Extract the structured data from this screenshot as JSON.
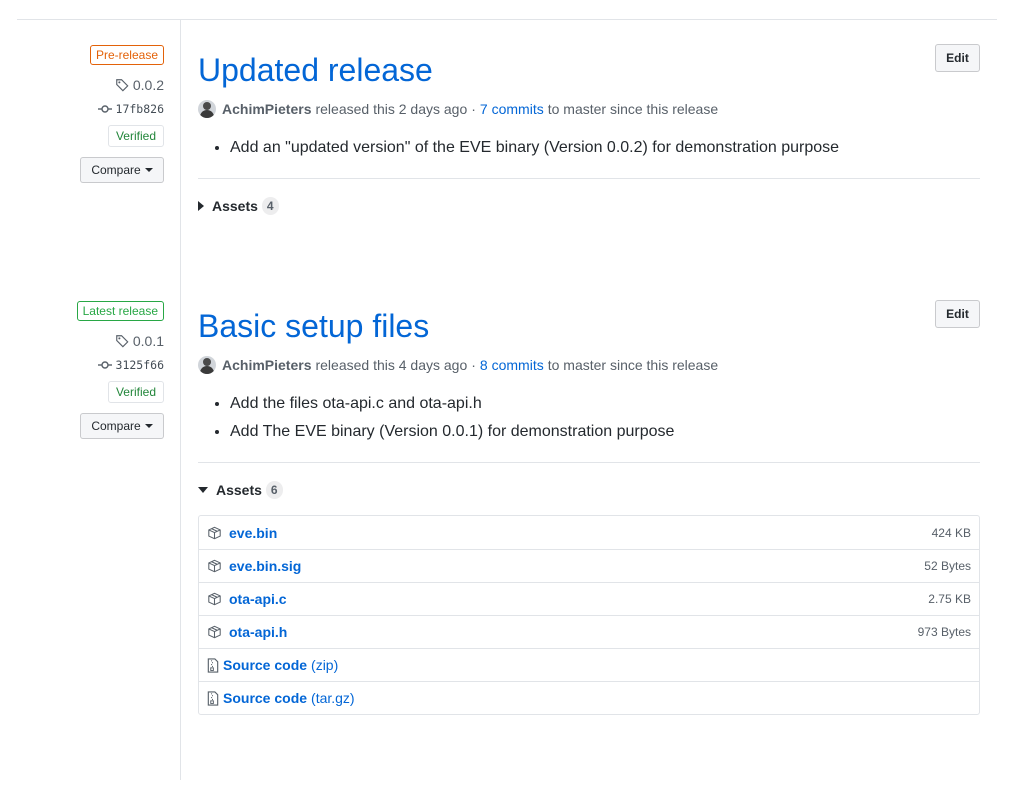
{
  "releases": [
    {
      "label": "Pre-release",
      "tag": "0.0.2",
      "commit": "17fb826",
      "verified": "Verified",
      "compare": "Compare",
      "edit": "Edit",
      "title": "Updated release",
      "author": "AchimPieters",
      "released_text": "released this 2 days ago",
      "sep": "·",
      "commits_link": "7 commits",
      "commits_suffix": "to master since this release",
      "notes": [
        "Add an \"updated version\" of the EVE binary (Version 0.0.2) for demonstration purpose"
      ],
      "assets_label": "Assets",
      "assets_count": "4",
      "assets_expanded": false
    },
    {
      "label": "Latest release",
      "tag": "0.0.1",
      "commit": "3125f66",
      "verified": "Verified",
      "compare": "Compare",
      "edit": "Edit",
      "title": "Basic setup files",
      "author": "AchimPieters",
      "released_text": "released this 4 days ago",
      "sep": "·",
      "commits_link": "8 commits",
      "commits_suffix": "to master since this release",
      "notes": [
        "Add the files ota-api.c and ota-api.h",
        "Add The EVE binary (Version 0.0.1) for demonstration purpose"
      ],
      "assets_label": "Assets",
      "assets_count": "6",
      "assets_expanded": true,
      "assets": [
        {
          "name": "eve.bin",
          "size": "424 KB",
          "icon": "package-icon"
        },
        {
          "name": "eve.bin.sig",
          "size": "52 Bytes",
          "icon": "package-icon"
        },
        {
          "name": "ota-api.c",
          "size": "2.75 KB",
          "icon": "package-icon"
        },
        {
          "name": "ota-api.h",
          "size": "973 Bytes",
          "icon": "package-icon"
        }
      ],
      "source": [
        {
          "name": "Source code",
          "ext": "(zip)",
          "icon": "file-zip-icon"
        },
        {
          "name": "Source code",
          "ext": "(tar.gz)",
          "icon": "file-zip-icon"
        }
      ]
    }
  ],
  "colors": {
    "link": "#0366d6",
    "prerelease": "#e36209",
    "latest": "#28a745",
    "verified": "#22863a"
  }
}
